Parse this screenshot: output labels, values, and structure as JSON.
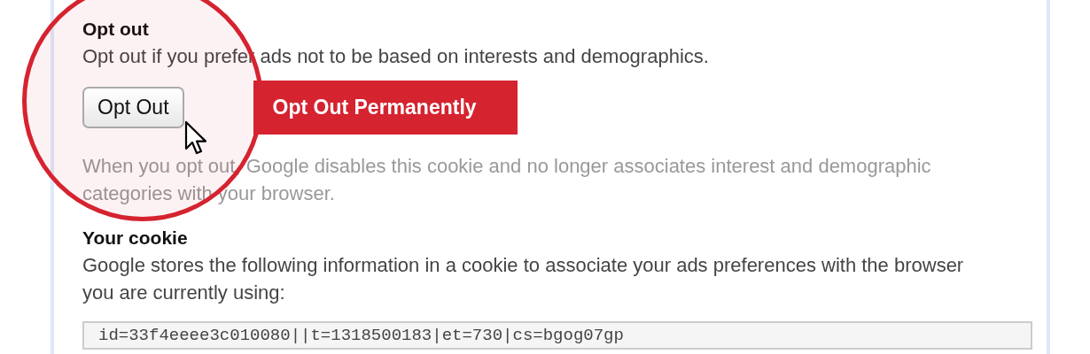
{
  "opt_out": {
    "title": "Opt out",
    "description": "Opt out if you prefer ads not to be based on interests and demographics.",
    "buttons": [
      {
        "label": "Opt Out",
        "kind": "button"
      },
      {
        "label": "Opt Out Permanently",
        "kind": "banner"
      }
    ],
    "note": "When you opt out, Google disables this cookie and no longer associates interest and demographic categories with your browser."
  },
  "cookie": {
    "title": "Your cookie",
    "description": "Google stores the following information in a cookie to associate your ads preferences with the browser you are currently using:",
    "value": "id=33f4eeee3c010080||t=1318500183|et=730|cs=bgog07gp"
  }
}
